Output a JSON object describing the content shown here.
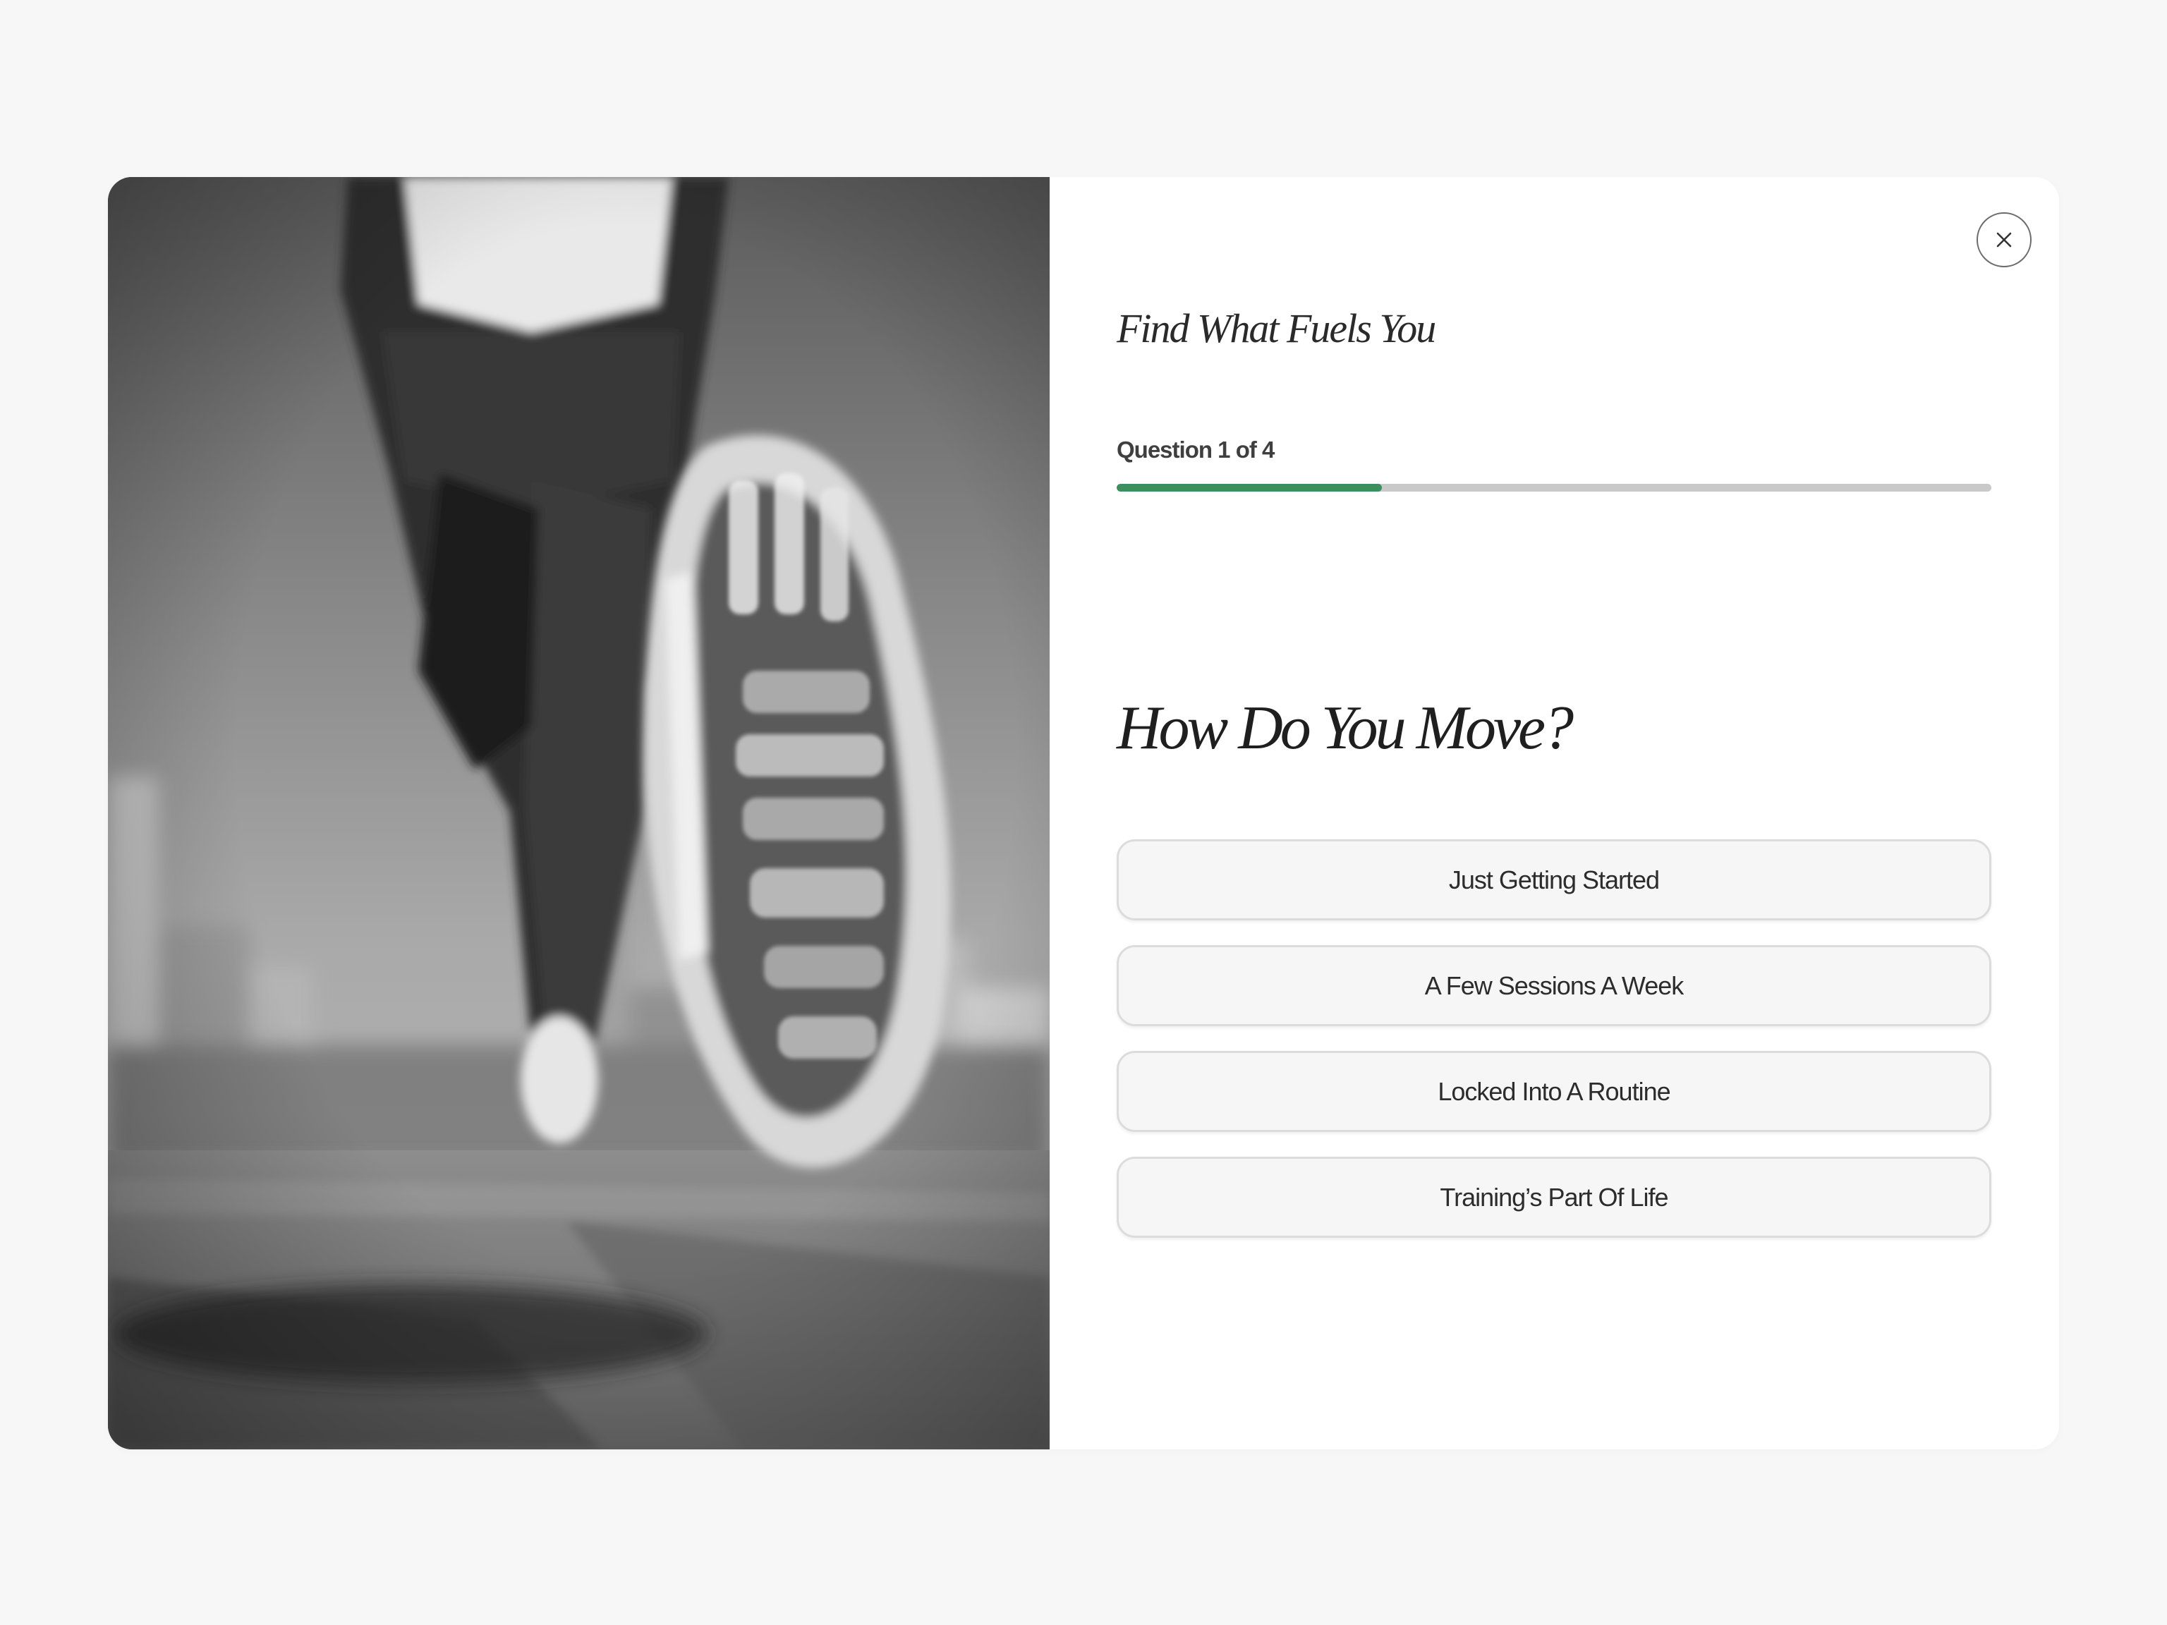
{
  "modal": {
    "eyebrow": "Find What Fuels You",
    "close_icon": "close-icon",
    "progress": {
      "label": "Question 1 of 4",
      "current": 1,
      "total": 4,
      "fill_fraction": 0.303,
      "fill_color": "#3a8f5c",
      "track_color": "#c9c9c9"
    },
    "question": "How Do You Move?",
    "options": [
      {
        "label": "Just Getting Started"
      },
      {
        "label": "A Few Sessions A Week"
      },
      {
        "label": "Locked Into A Routine"
      },
      {
        "label": "Training’s Part Of Life"
      }
    ]
  },
  "image": {
    "subject": "runner-photo"
  }
}
